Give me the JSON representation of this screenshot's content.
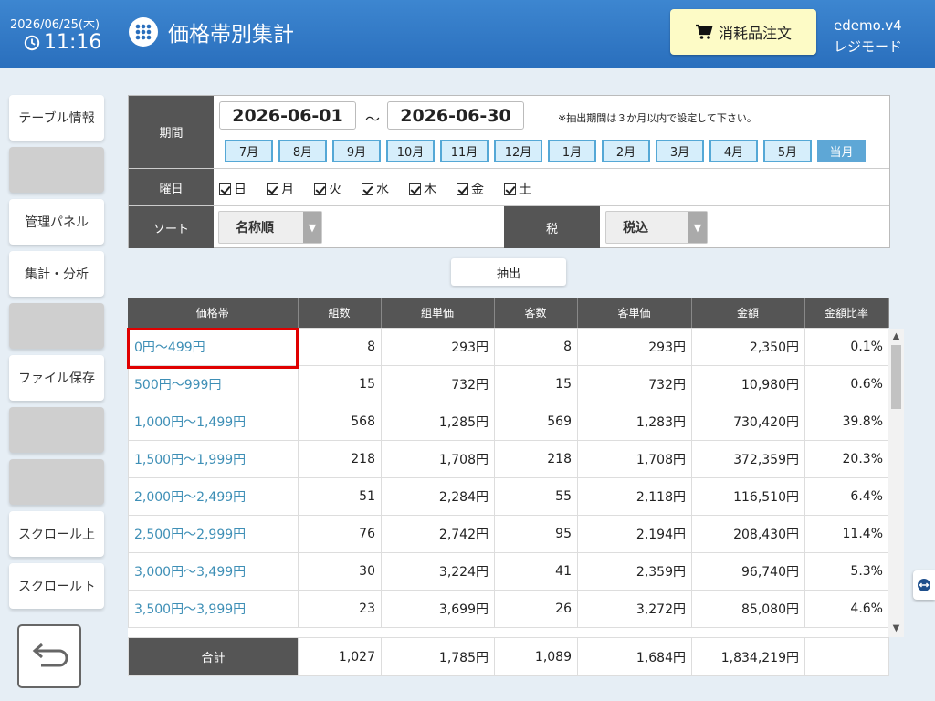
{
  "header": {
    "date": "2026/06/25(木)",
    "time": "11:16",
    "title": "価格帯別集計",
    "order_button": "消耗品注文",
    "user": "edemo.v4",
    "mode": "レジモード"
  },
  "sidebar": {
    "items": [
      "テーブル情報",
      "",
      "管理パネル",
      "集計・分析",
      "",
      "ファイル保存",
      "",
      "",
      "スクロール上",
      "スクロール下"
    ]
  },
  "filter": {
    "period_label": "期間",
    "start_date": "2026-06-01",
    "tilde": "～",
    "end_date": "2026-06-30",
    "note": "※抽出期間は３か月以内で設定して下さい。",
    "months": [
      "7月",
      "8月",
      "9月",
      "10月",
      "11月",
      "12月",
      "1月",
      "2月",
      "3月",
      "4月",
      "5月",
      "当月"
    ],
    "weekday_label": "曜日",
    "weekdays": [
      "日",
      "月",
      "火",
      "水",
      "木",
      "金",
      "土"
    ],
    "sort_label": "ソート",
    "sort_value": "名称順",
    "tax_label": "税",
    "tax_value": "税込"
  },
  "extract_button": "抽出",
  "table": {
    "headers": [
      "価格帯",
      "組数",
      "組単価",
      "客数",
      "客単価",
      "金額",
      "金額比率"
    ],
    "rows": [
      [
        "0円～499円",
        "8",
        "293円",
        "8",
        "293円",
        "2,350円",
        "0.1%"
      ],
      [
        "500円～999円",
        "15",
        "732円",
        "15",
        "732円",
        "10,980円",
        "0.6%"
      ],
      [
        "1,000円～1,499円",
        "568",
        "1,285円",
        "569",
        "1,283円",
        "730,420円",
        "39.8%"
      ],
      [
        "1,500円～1,999円",
        "218",
        "1,708円",
        "218",
        "1,708円",
        "372,359円",
        "20.3%"
      ],
      [
        "2,000円～2,499円",
        "51",
        "2,284円",
        "55",
        "2,118円",
        "116,510円",
        "6.4%"
      ],
      [
        "2,500円～2,999円",
        "76",
        "2,742円",
        "95",
        "2,194円",
        "208,430円",
        "11.4%"
      ],
      [
        "3,000円～3,499円",
        "30",
        "3,224円",
        "41",
        "2,359円",
        "96,740円",
        "5.3%"
      ],
      [
        "3,500円～3,999円",
        "23",
        "3,699円",
        "26",
        "3,272円",
        "85,080円",
        "4.6%"
      ]
    ],
    "total": [
      "合計",
      "1,027",
      "1,785円",
      "1,089",
      "1,684円",
      "1,834,219円",
      ""
    ]
  },
  "colors": {
    "header_bg": "#2a6fbd",
    "order_button_bg": "#fdfbc6",
    "label_bg": "#555555",
    "link": "#3e8fb6",
    "highlight": "#e00000"
  }
}
